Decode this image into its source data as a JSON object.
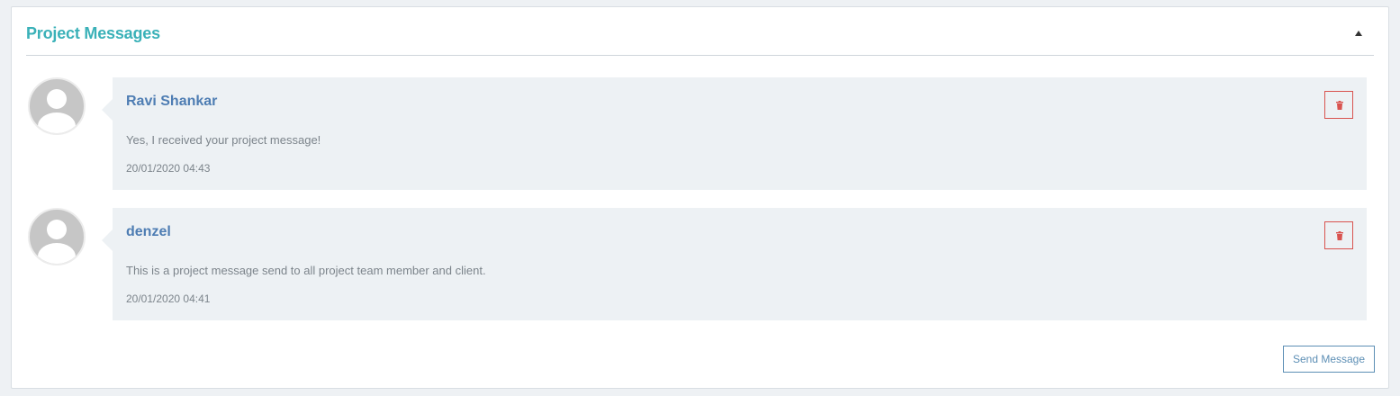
{
  "panel": {
    "title": "Project Messages",
    "collapse_icon": "caret-up-icon"
  },
  "messages": [
    {
      "author": "Ravi Shankar",
      "text": "Yes, I received your project message!",
      "date": "20/01/2020 04:43",
      "avatar_icon": "default-user-avatar",
      "delete_icon": "trash-icon"
    },
    {
      "author": "denzel",
      "text": "This is a project message send to all project team member and client.",
      "date": "20/01/2020 04:41",
      "avatar_icon": "default-user-avatar",
      "delete_icon": "trash-icon"
    }
  ],
  "actions": {
    "send_label": "Send Message"
  },
  "colors": {
    "title": "#3ab1b8",
    "author": "#4e7db3",
    "delete": "#d9534f",
    "send_button": "#5d8fb5",
    "bubble_bg": "#edf1f4"
  }
}
